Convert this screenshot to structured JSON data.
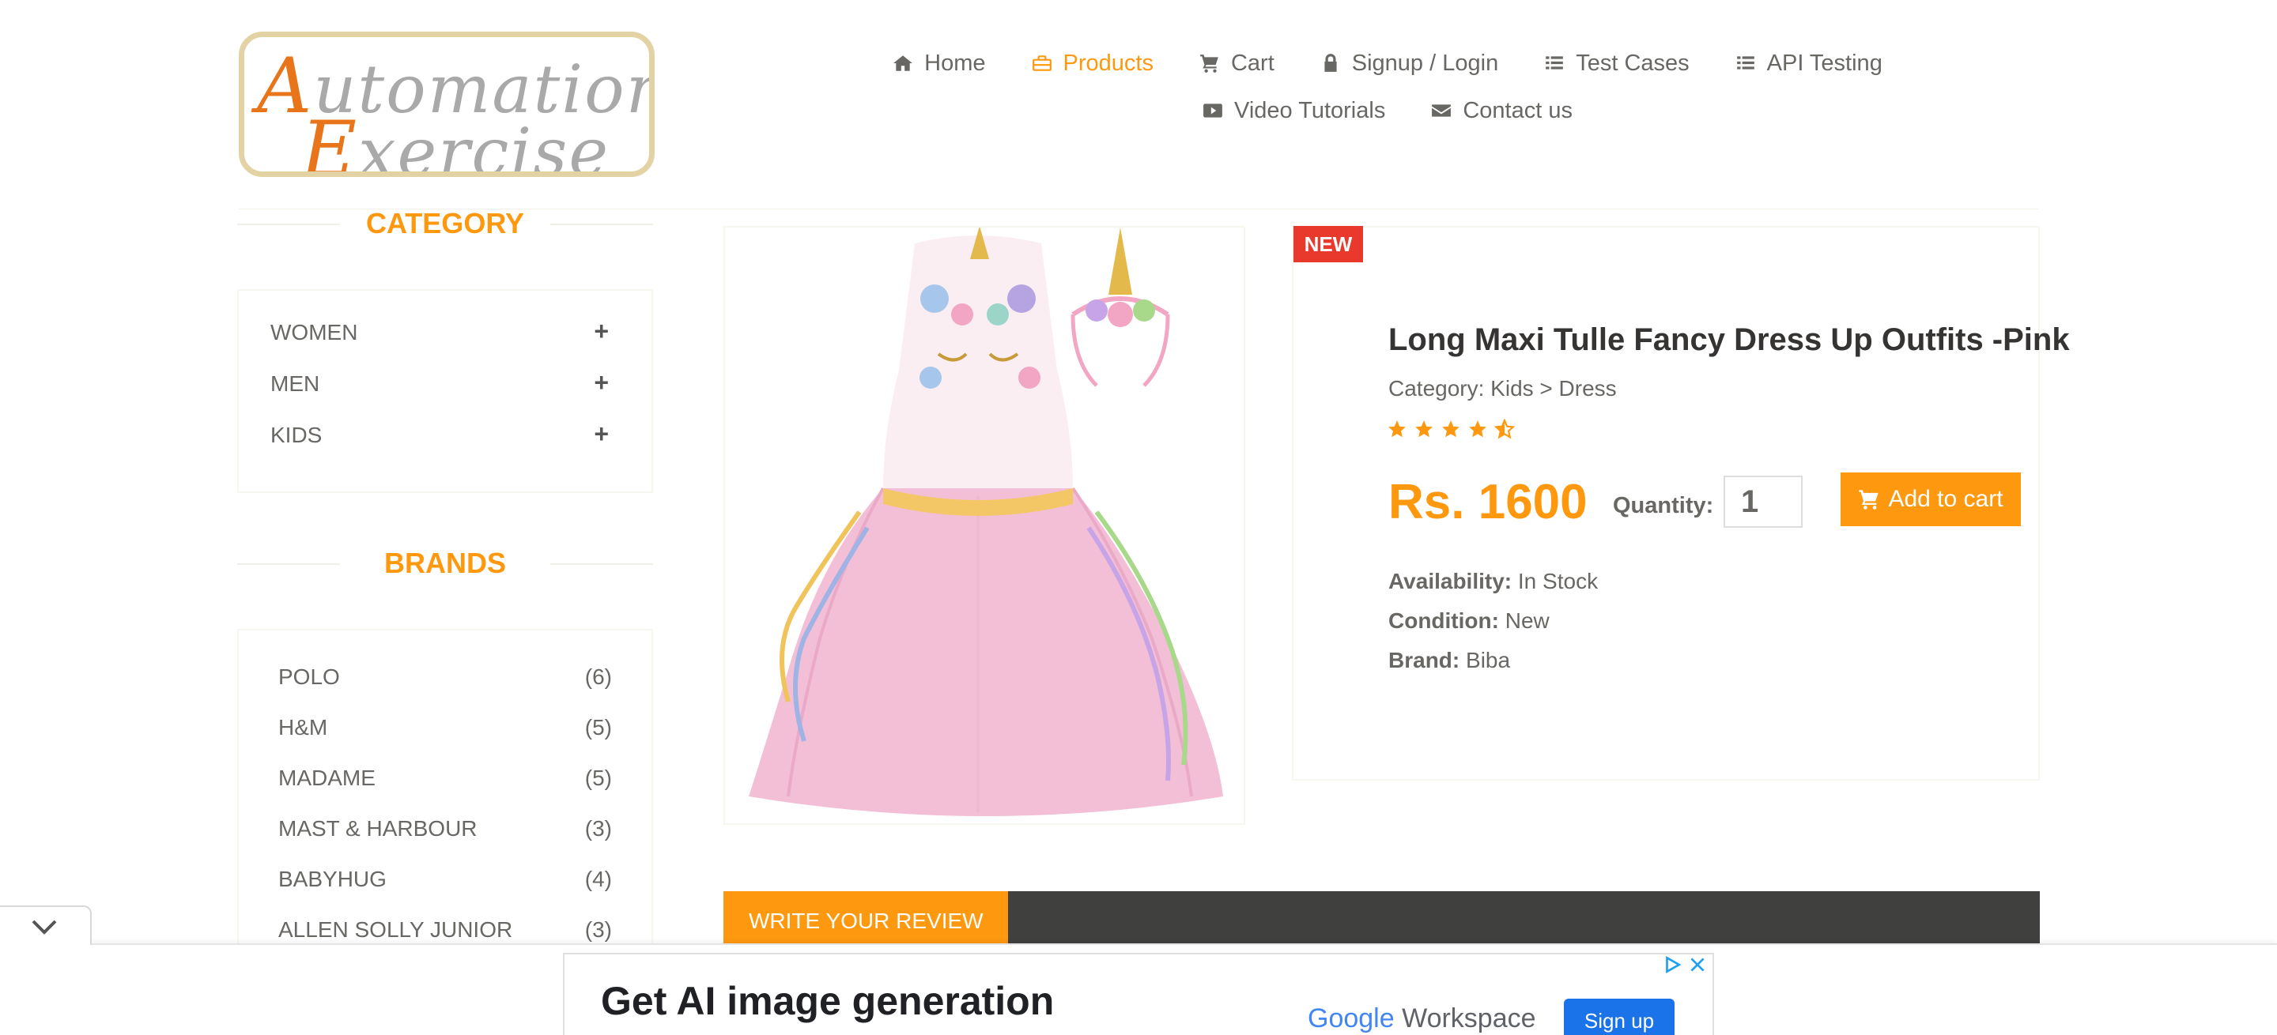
{
  "header": {
    "logo": {
      "line1": "Automation",
      "line2": "Exercise"
    },
    "nav": {
      "row1": [
        {
          "label": "Home",
          "icon": "home-icon"
        },
        {
          "label": "Products",
          "icon": "briefcase-icon",
          "active": true
        },
        {
          "label": "Cart",
          "icon": "cart-icon"
        },
        {
          "label": "Signup / Login",
          "icon": "lock-icon"
        },
        {
          "label": "Test Cases",
          "icon": "list-icon"
        },
        {
          "label": "API Testing",
          "icon": "list-icon"
        }
      ],
      "row2": [
        {
          "label": "Video Tutorials",
          "icon": "youtube-icon"
        },
        {
          "label": "Contact us",
          "icon": "envelope-icon"
        }
      ]
    }
  },
  "sidebar": {
    "category_title": "CATEGORY",
    "categories": [
      "WOMEN",
      "MEN",
      "KIDS"
    ],
    "brands_title": "BRANDS",
    "brands": [
      {
        "name": "POLO",
        "count": "(6)"
      },
      {
        "name": "H&M",
        "count": "(5)"
      },
      {
        "name": "MADAME",
        "count": "(5)"
      },
      {
        "name": "MAST & HARBOUR",
        "count": "(3)"
      },
      {
        "name": "BABYHUG",
        "count": "(4)"
      },
      {
        "name": "ALLEN SOLLY JUNIOR",
        "count": "(3)"
      }
    ]
  },
  "product": {
    "badge": "NEW",
    "title": "Long Maxi Tulle Fancy Dress Up Outfits -Pink",
    "category": "Category: Kids > Dress",
    "rating": 4.5,
    "price": "Rs. 1600",
    "quantity_label": "Quantity:",
    "quantity": "1",
    "add_to_cart": "Add to cart",
    "availability_label": "Availability:",
    "availability": "In Stock",
    "condition_label": "Condition:",
    "condition": "New",
    "brand_label": "Brand:",
    "brand": "Biba"
  },
  "review": {
    "tab_label": "WRITE YOUR REVIEW"
  },
  "ad": {
    "headline": "Get AI image generation",
    "brand_google": "Google",
    "brand_workspace": "Workspace",
    "cta": "Sign up"
  },
  "colors": {
    "accent": "#fe980f",
    "badge": "#e8392c",
    "review_bar": "#40403e",
    "text": "#696763"
  }
}
